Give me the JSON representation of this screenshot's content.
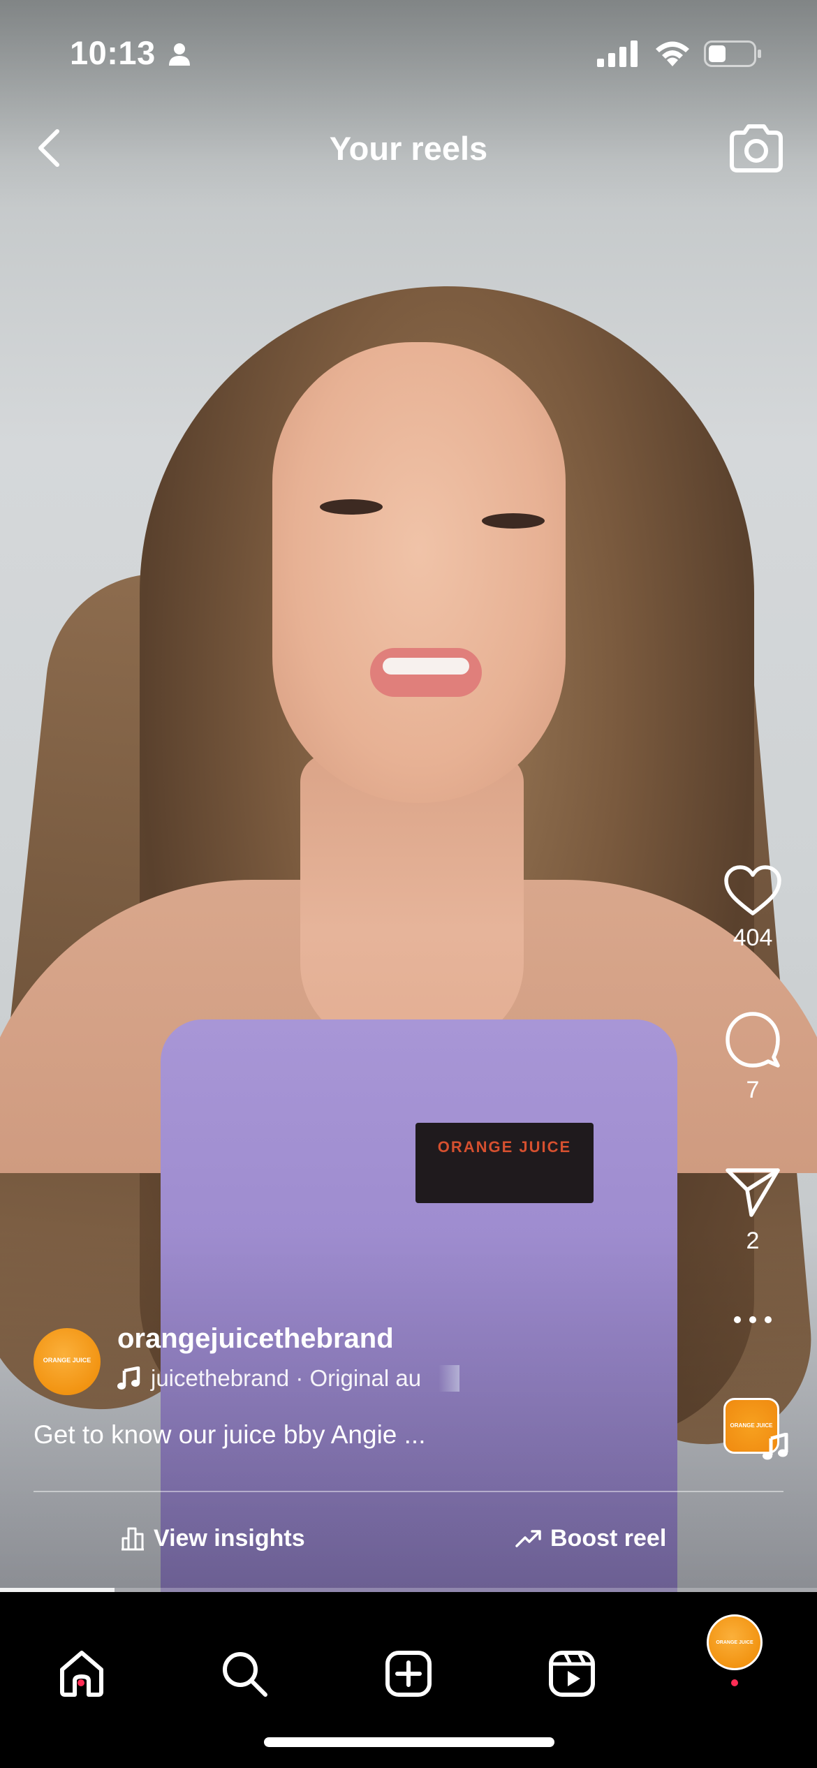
{
  "status_bar": {
    "time": "10:13"
  },
  "header": {
    "title": "Your reels"
  },
  "video": {
    "patch_text": "ORANGE JUICE",
    "progress": 0.14
  },
  "actions": {
    "likes": "404",
    "comments": "7",
    "shares": "2"
  },
  "post": {
    "username": "orangejuicethebrand",
    "avatar_text": "ORANGE JUICE",
    "audio": "juicethebrand · Original au",
    "caption": "Get to know our juice bby Angie ...",
    "insights_label": "View insights",
    "boost_label": "Boost reel"
  },
  "tabbar": {
    "items": [
      "home-icon",
      "search-icon",
      "create-icon",
      "reels-icon",
      "profile-avatar"
    ],
    "profile_text": "ORANGE JUICE"
  },
  "colors": {
    "accent_dot": "#ff2d55",
    "brand_orange": "#f29412"
  }
}
